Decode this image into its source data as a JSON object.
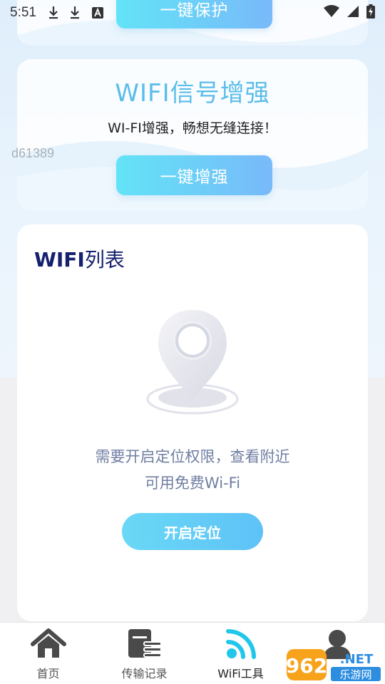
{
  "status_bar": {
    "time": "5:51",
    "icons": [
      "download-icon",
      "download-icon",
      "font-icon",
      "wifi-signal-icon",
      "cell-signal-icon",
      "battery-charging-icon"
    ]
  },
  "protect_card": {
    "button_label": "一键保护"
  },
  "boost_card": {
    "title": "WIFI信号增强",
    "subtitle": "WI-FI增强，畅想无缝连接！",
    "button_label": "一键增强"
  },
  "watermark": "d61389",
  "wifi_list": {
    "title_bold": "WIFI",
    "title_rest": "列表",
    "permission_line1": "需要开启定位权限，查看附近",
    "permission_line2": "可用免费Wi-Fi",
    "locate_button": "开启定位"
  },
  "tabbar": {
    "items": [
      {
        "label": "首页",
        "icon": "home-icon",
        "active": false
      },
      {
        "label": "传输记录",
        "icon": "transfer-record-icon",
        "active": false
      },
      {
        "label": "WiFi工具",
        "icon": "wifi-icon",
        "active": true
      },
      {
        "label": "",
        "icon": "profile-icon",
        "active": false
      }
    ]
  },
  "logo": {
    "text_main": "962",
    "text_suffix": ".NET",
    "text_sub": "乐游网"
  },
  "colors": {
    "accent_cyan": "#5bbde9",
    "title_navy": "#15206e",
    "wifi_active": "#21c7ea"
  }
}
